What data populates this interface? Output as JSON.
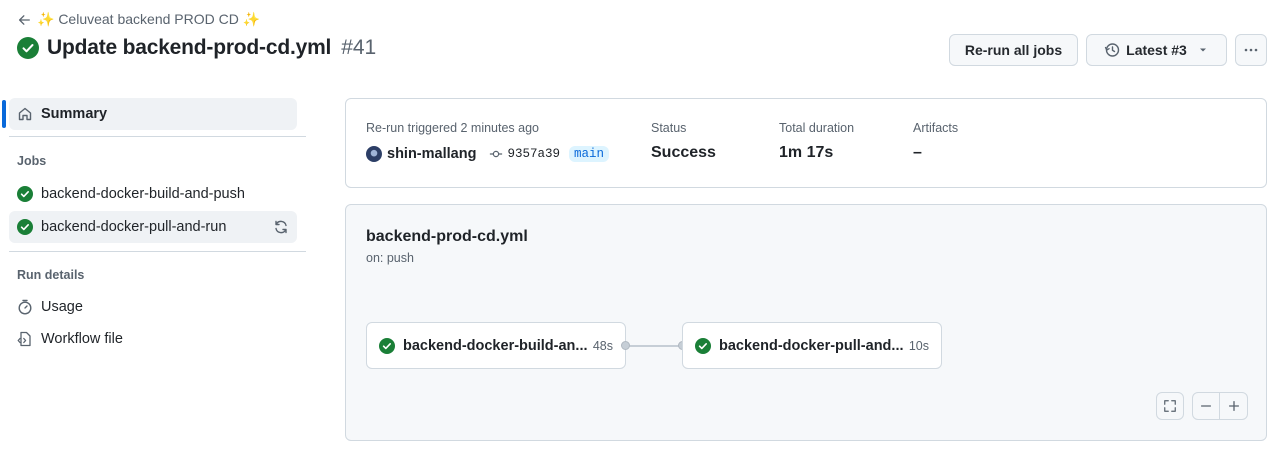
{
  "header": {
    "back_label": "✨ Celuveat backend PROD CD ✨",
    "title": "Update backend-prod-cd.yml",
    "run_number": "#41",
    "rerun_all_label": "Re-run all jobs",
    "latest_label": "Latest #3",
    "icons": {
      "back": "arrow-left-icon",
      "status": "check-circle-icon",
      "history": "history-icon",
      "caret": "triangle-down-icon",
      "more": "kebab-horizontal-icon"
    }
  },
  "sidebar": {
    "summary_label": "Summary",
    "jobs_heading": "Jobs",
    "jobs": [
      {
        "label": "backend-docker-build-and-push",
        "status": "success"
      },
      {
        "label": "backend-docker-pull-and-run",
        "status": "success"
      }
    ],
    "run_details_heading": "Run details",
    "usage_label": "Usage",
    "workflow_file_label": "Workflow file"
  },
  "run_summary": {
    "trigger_text": "Re-run triggered 2 minutes ago",
    "actor": "shin-mallang",
    "commit": "9357a39",
    "branch": "main",
    "status_label": "Status",
    "status_value": "Success",
    "duration_label": "Total duration",
    "duration_value": "1m 17s",
    "artifacts_label": "Artifacts",
    "artifacts_value": "–"
  },
  "workflow_graph": {
    "file_name": "backend-prod-cd.yml",
    "trigger": "on: push",
    "jobs": [
      {
        "name": "backend-docker-build-an...",
        "duration": "48s"
      },
      {
        "name": "backend-docker-pull-and...",
        "duration": "10s"
      }
    ]
  },
  "colors": {
    "success": "#1a7f37",
    "accent": "#0969da",
    "border": "#d1d9e0"
  }
}
